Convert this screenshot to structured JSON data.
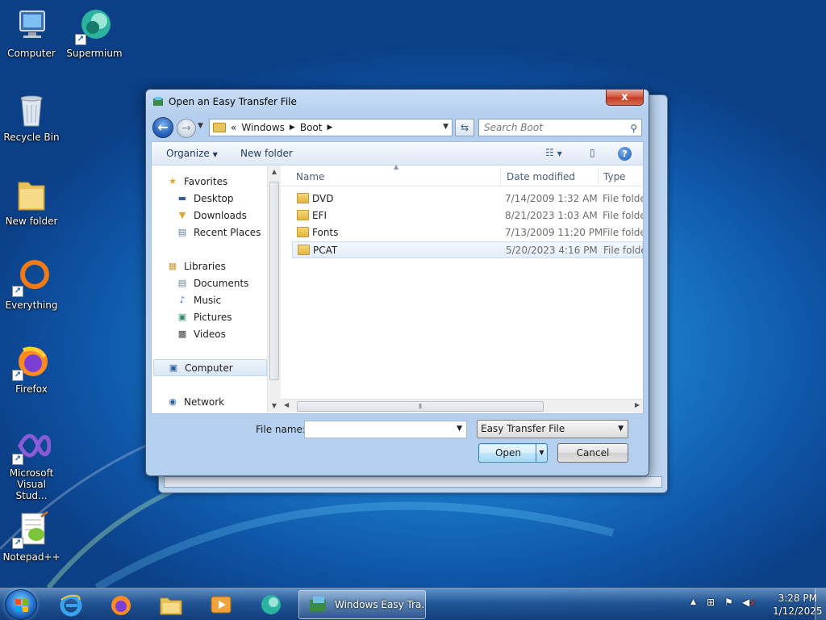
{
  "desktop": {
    "icons": [
      {
        "label": "Computer"
      },
      {
        "label": "Supermium"
      },
      {
        "label": "Recycle Bin"
      },
      {
        "label": "New folder"
      },
      {
        "label": "Everything"
      },
      {
        "label": "Firefox"
      },
      {
        "label": "Microsoft Visual Stud..."
      },
      {
        "label": "Notepad++"
      }
    ]
  },
  "dialog": {
    "title": "Open an Easy Transfer File",
    "close_label": "x",
    "address": {
      "prefix": "«",
      "crumbs": [
        "Windows",
        "Boot"
      ]
    },
    "search_placeholder": "Search Boot",
    "toolbar": {
      "organize": "Organize",
      "new_folder": "New folder",
      "help": "?"
    },
    "nav": {
      "favorites": "Favorites",
      "fav_items": [
        "Desktop",
        "Downloads",
        "Recent Places"
      ],
      "libraries": "Libraries",
      "lib_items": [
        "Documents",
        "Music",
        "Pictures",
        "Videos"
      ],
      "computer": "Computer",
      "network": "Network"
    },
    "columns": {
      "name": "Name",
      "date": "Date modified",
      "type": "Type"
    },
    "files": [
      {
        "name": "DVD",
        "date": "7/14/2009 1:32 AM",
        "type": "File folder"
      },
      {
        "name": "EFI",
        "date": "8/21/2023 1:03 AM",
        "type": "File folder"
      },
      {
        "name": "Fonts",
        "date": "7/13/2009 11:20 PM",
        "type": "File folder"
      },
      {
        "name": "PCAT",
        "date": "5/20/2023 4:16 PM",
        "type": "File folder"
      }
    ],
    "file_name_label": "File name:",
    "file_name_value": "",
    "file_type": "Easy Transfer File",
    "open_label": "Open",
    "cancel_label": "Cancel"
  },
  "taskbar": {
    "active_task": "Windows Easy Tra...",
    "clock_time": "3:28 PM",
    "clock_date": "1/12/2025"
  },
  "colors": {
    "accent": "#1a78c8",
    "close": "#c23a22"
  }
}
